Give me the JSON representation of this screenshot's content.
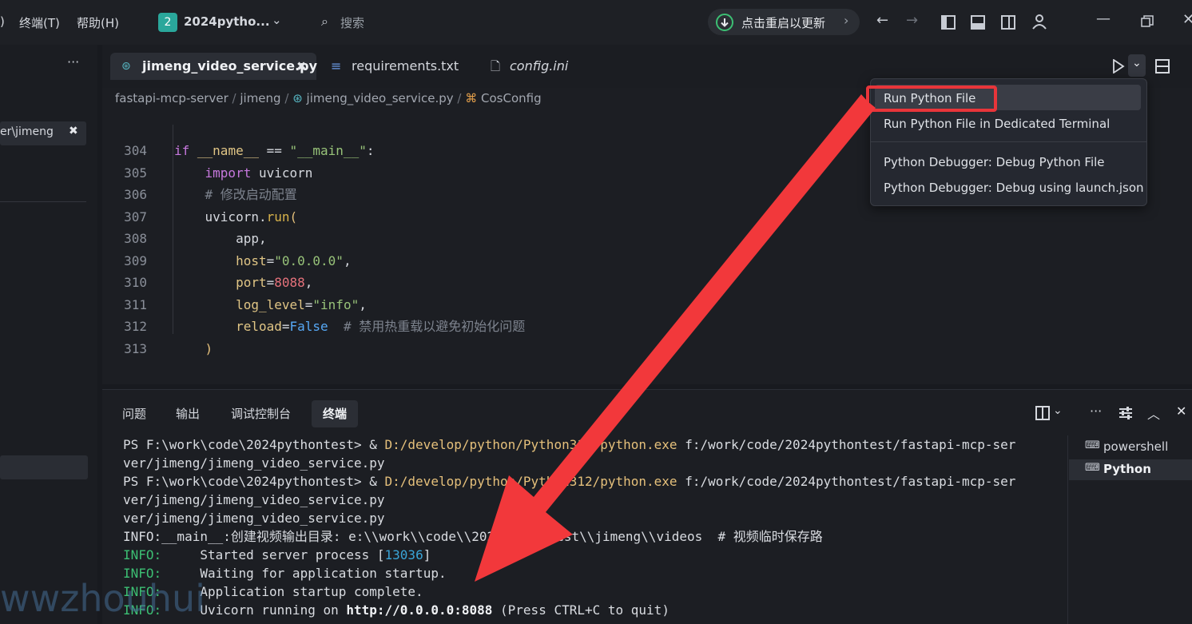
{
  "titlebar": {
    "menu_items": [
      ")",
      "终端(T)",
      "帮助(H)"
    ],
    "workspace_badge": "2",
    "workspace_name": "2024pytho...",
    "search_placeholder": "搜索",
    "update_label": "点击重启以更新"
  },
  "sidebar": {
    "open_item_label": "er\\jimeng",
    "more_label": "···"
  },
  "editor": {
    "tabs": [
      {
        "label": "jimeng_video_service.py",
        "active": true
      },
      {
        "label": "requirements.txt",
        "active": false
      },
      {
        "label": "config.ini",
        "active": false
      }
    ],
    "breadcrumb": [
      "fastapi-mcp-server",
      "jimeng",
      "jimeng_video_service.py",
      "CosConfig"
    ],
    "line_numbers": [
      "304",
      "305",
      "306",
      "307",
      "308",
      "309",
      "310",
      "311",
      "312",
      "313"
    ]
  },
  "run_menu": {
    "items": [
      "Run Python File",
      "Run Python File in Dedicated Terminal",
      "Python Debugger: Debug Python File",
      "Python Debugger: Debug using launch.json"
    ]
  },
  "panel": {
    "tabs": [
      "问题",
      "输出",
      "调试控制台",
      "终端"
    ],
    "active_tab": "终端",
    "terminal_list": [
      "powershell",
      "Python"
    ],
    "terminal_lines": [
      "PS F:\\work\\code\\2024pythontest> & ",
      "D:/develop/python/Python312/python.exe",
      " f:/work/code/2024pythontest/fastapi-mcp-ser",
      "ver/jimeng/jimeng_video_service.py",
      "INFO:__main__:创建视频输出目录: e:\\\\work\\\\code\\\\2024pythontest\\\\jimeng\\\\videos  # 视频临时保存路",
      "INFO:",
      "     Started server process [",
      "13036",
      "]",
      "     Waiting for application startup.",
      "     Application startup complete.",
      "     Uvicorn running on ",
      "http://0.0.0.0:8088",
      " (Press CTRL+C to quit)"
    ]
  },
  "watermark": "wwzhouhui",
  "colors": {
    "highlight_box": "#e8353a",
    "arrow": "#f2383b",
    "badge": "#2aa79b"
  }
}
